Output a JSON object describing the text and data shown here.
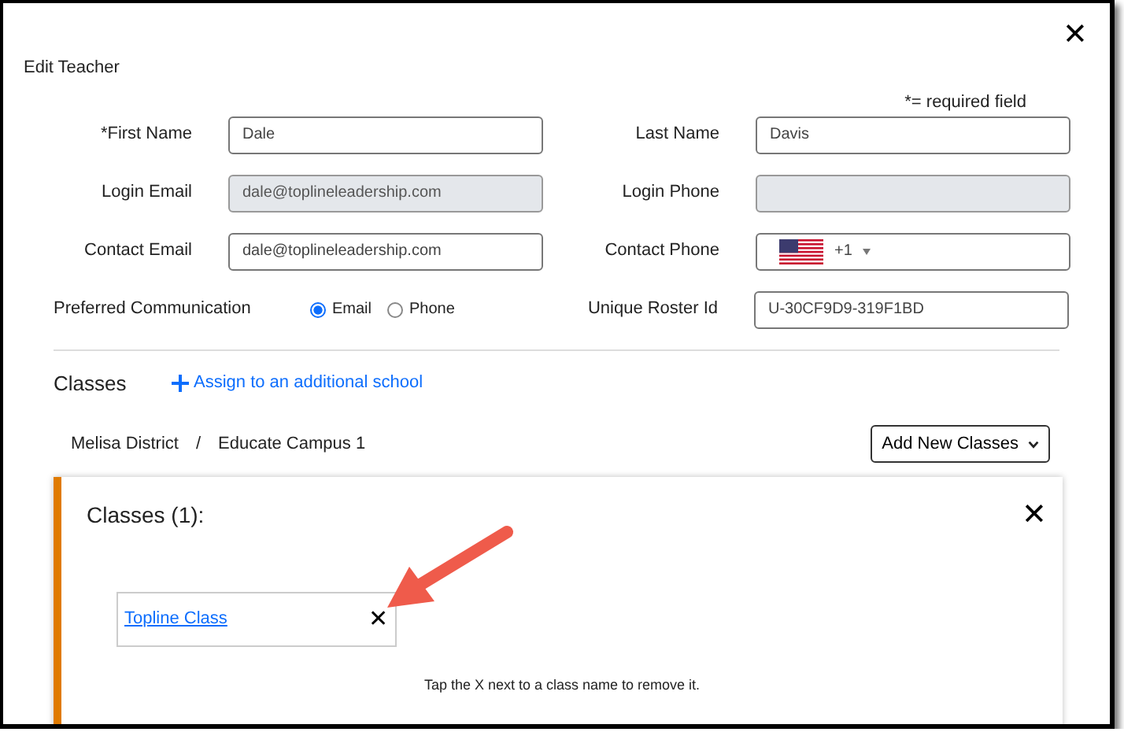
{
  "dialog": {
    "title": "Edit Teacher",
    "close_label": "✕",
    "required_note": "*= required field",
    "rows": [
      {
        "left": {
          "kind": "text",
          "label": "*First Name",
          "value": "Dale",
          "disabled": false
        },
        "right": {
          "kind": "text",
          "label": "Last Name",
          "value": "Davis",
          "disabled": false
        }
      },
      {
        "left": {
          "kind": "text",
          "label": "Login Email",
          "value": "dale@toplineleadership.com",
          "disabled": true
        },
        "right": {
          "kind": "text",
          "label": "Login Phone",
          "disabled": true
        }
      },
      {
        "left": {
          "kind": "text",
          "label": "Contact Email",
          "value": "dale@toplineleadership.com",
          "disabled": false
        },
        "right": {
          "kind": "phone",
          "label": "Contact Phone",
          "country_code": "+1"
        }
      },
      {
        "left": {
          "kind": "radio",
          "label": "Preferred Communication",
          "options": [
            {
              "label": "Email",
              "selected": true
            },
            {
              "label": "Phone",
              "selected": false
            }
          ]
        },
        "right": {
          "kind": "text",
          "label": "Unique Roster Id",
          "value": "U-30CF9D9-319F1BD",
          "disabled": false
        }
      }
    ]
  },
  "classes": {
    "title": "Classes",
    "assign_link": "Assign to an additional school",
    "breadcrumb": [
      "Melisa District",
      "Educate Campus 1"
    ],
    "separator": "/",
    "add_select": "Add New Classes",
    "card": {
      "title": "Classes (1):",
      "close_label": "✕",
      "items": [
        {
          "name": "Topline Class",
          "remove_label": "✕"
        }
      ],
      "hint": "Tap the X next to a class name to remove it."
    }
  }
}
